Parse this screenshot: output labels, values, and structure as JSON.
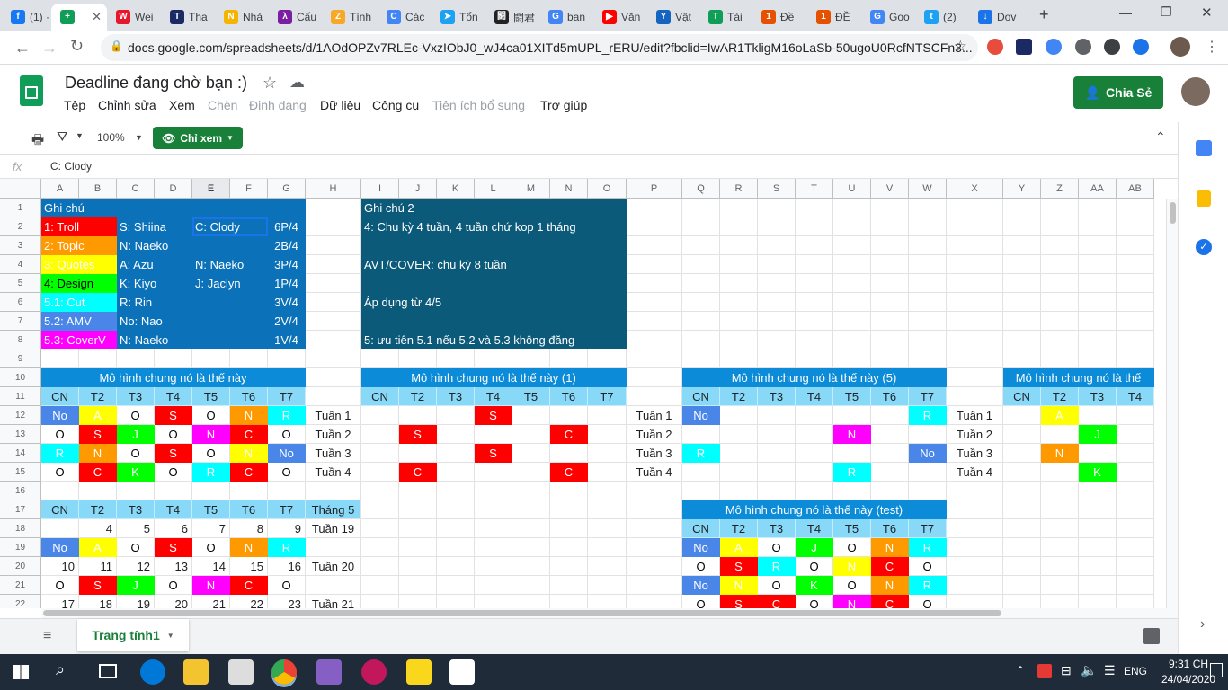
{
  "browser": {
    "tabs": [
      {
        "label": "(1) ·",
        "fav_color": "#1877f2",
        "fav_text": "f"
      },
      {
        "label": "",
        "fav_color": "#0f9d58",
        "fav_text": "+"
      },
      {
        "label": "Wei",
        "fav_color": "#e6162d",
        "fav_text": "W"
      },
      {
        "label": "Tha",
        "fav_color": "#1b2a63",
        "fav_text": "T"
      },
      {
        "label": "Nhả",
        "fav_color": "#f4b400",
        "fav_text": "N"
      },
      {
        "label": "Cấu",
        "fav_color": "#7b1fa2",
        "fav_text": "λ"
      },
      {
        "label": "Tính",
        "fav_color": "#f9a825",
        "fav_text": "Z"
      },
      {
        "label": "Các",
        "fav_color": "#4285f4",
        "fav_text": "C"
      },
      {
        "label": "Tổn",
        "fav_color": "#1da1f2",
        "fav_text": "➤"
      },
      {
        "label": "闘君",
        "fav_color": "#222222",
        "fav_text": "闘"
      },
      {
        "label": "ban",
        "fav_color": "#4285f4",
        "fav_text": "G"
      },
      {
        "label": "Văn",
        "fav_color": "#ff0000",
        "fav_text": "▶"
      },
      {
        "label": "Vật",
        "fav_color": "#1565c0",
        "fav_text": "Y"
      },
      {
        "label": "Tài",
        "fav_color": "#0f9d58",
        "fav_text": "T"
      },
      {
        "label": "Đề",
        "fav_color": "#e65100",
        "fav_text": "1"
      },
      {
        "label": "ĐỀ",
        "fav_color": "#e65100",
        "fav_text": "1"
      },
      {
        "label": "Goo",
        "fav_color": "#4285f4",
        "fav_text": "G"
      },
      {
        "label": "(2)",
        "fav_color": "#1da1f2",
        "fav_text": "t"
      },
      {
        "label": "Dov",
        "fav_color": "#1a73e8",
        "fav_text": "↓"
      }
    ],
    "new_tab": "+",
    "url": "docs.google.com/spreadsheets/d/1AOdOPZv7RLEc-VxzIObJ0_wJ4ca01XITd5mUPL_rERU/edit?fbclid=IwAR1TkligM16oLaSb-50ugoU0RcfNTSCFn3..."
  },
  "sheet": {
    "title": "Deadline đang chờ bạn :)",
    "menu": [
      {
        "label": "Tệp",
        "disabled": false
      },
      {
        "label": "Chỉnh sửa",
        "disabled": false
      },
      {
        "label": "Xem",
        "disabled": false
      },
      {
        "label": "Chèn",
        "disabled": true
      },
      {
        "label": "Định dạng",
        "disabled": true
      },
      {
        "label": "Dữ liệu",
        "disabled": false
      },
      {
        "label": "Công cụ",
        "disabled": false
      },
      {
        "label": "Tiện ích bổ sung",
        "disabled": true
      },
      {
        "label": "Trợ giúp",
        "disabled": false
      }
    ],
    "share_label": "Chia Sẻ",
    "zoom": "100%",
    "view_mode": "Chỉ xem",
    "fx_label": "fx",
    "formula": "C: Clody",
    "sheet_tab": "Trang tính1"
  },
  "grid": {
    "columns": [
      "A",
      "B",
      "C",
      "D",
      "E",
      "F",
      "G",
      "H",
      "I",
      "J",
      "K",
      "L",
      "M",
      "N",
      "O",
      "P",
      "Q",
      "R",
      "S",
      "T",
      "U",
      "V",
      "W",
      "X",
      "Y",
      "Z",
      "AA",
      "AB"
    ],
    "rows": [
      "1",
      "2",
      "3",
      "4",
      "5",
      "6",
      "7",
      "8",
      "9",
      "10",
      "11",
      "12",
      "13",
      "14",
      "15",
      "16",
      "17",
      "18",
      "19",
      "20",
      "21",
      "22"
    ],
    "cells": [
      {
        "r": 0,
        "c": 0,
        "span": 7,
        "t": "Ghi chú",
        "bg": "#0b71b9",
        "fg": "#fff",
        "a": "l"
      },
      {
        "r": 1,
        "c": 0,
        "span": 2,
        "t": "1: Troll",
        "bg": "#ff0000",
        "fg": "#fff",
        "a": "l"
      },
      {
        "r": 2,
        "c": 0,
        "span": 2,
        "t": "2: Topic",
        "bg": "#ff9900",
        "fg": "#fff",
        "a": "l"
      },
      {
        "r": 3,
        "c": 0,
        "span": 2,
        "t": "3: Quotes",
        "bg": "#ffff00",
        "fg": "#fff",
        "a": "l"
      },
      {
        "r": 4,
        "c": 0,
        "span": 2,
        "t": "4: Design",
        "bg": "#00ff00",
        "fg": "#000",
        "a": "l"
      },
      {
        "r": 5,
        "c": 0,
        "span": 2,
        "t": "5.1: Cut",
        "bg": "#00ffff",
        "fg": "#fff",
        "a": "l"
      },
      {
        "r": 6,
        "c": 0,
        "span": 2,
        "t": "5.2: AMV",
        "bg": "#4a86e8",
        "fg": "#fff",
        "a": "l"
      },
      {
        "r": 7,
        "c": 0,
        "span": 2,
        "t": "5.3: CoverV",
        "bg": "#ff00ff",
        "fg": "#fff",
        "a": "l"
      },
      {
        "r": 1,
        "c": 2,
        "span": 2,
        "t": "S: Shiina",
        "bg": "#0b71b9",
        "fg": "#fff",
        "a": "l"
      },
      {
        "r": 2,
        "c": 2,
        "span": 2,
        "t": "N: Naeko",
        "bg": "#0b71b9",
        "fg": "#fff",
        "a": "l"
      },
      {
        "r": 3,
        "c": 2,
        "span": 2,
        "t": "A: Azu",
        "bg": "#0b71b9",
        "fg": "#fff",
        "a": "l"
      },
      {
        "r": 4,
        "c": 2,
        "span": 2,
        "t": "K: Kiyo",
        "bg": "#0b71b9",
        "fg": "#fff",
        "a": "l"
      },
      {
        "r": 5,
        "c": 2,
        "span": 2,
        "t": "R: Rin",
        "bg": "#0b71b9",
        "fg": "#fff",
        "a": "l"
      },
      {
        "r": 6,
        "c": 2,
        "span": 2,
        "t": "No: Nao",
        "bg": "#0b71b9",
        "fg": "#fff",
        "a": "l"
      },
      {
        "r": 7,
        "c": 2,
        "span": 2,
        "t": "N: Naeko",
        "bg": "#0b71b9",
        "fg": "#fff",
        "a": "l"
      },
      {
        "r": 1,
        "c": 4,
        "span": 2,
        "t": "C: Clody",
        "bg": "#0b71b9",
        "fg": "#fff",
        "a": "l",
        "sel": true
      },
      {
        "r": 2,
        "c": 4,
        "span": 2,
        "t": "",
        "bg": "#0b71b9",
        "fg": "#fff",
        "a": "l"
      },
      {
        "r": 3,
        "c": 4,
        "span": 2,
        "t": "N: Naeko",
        "bg": "#0b71b9",
        "fg": "#fff",
        "a": "l"
      },
      {
        "r": 4,
        "c": 4,
        "span": 2,
        "t": "J: Jaclyn",
        "bg": "#0b71b9",
        "fg": "#fff",
        "a": "l"
      },
      {
        "r": 5,
        "c": 4,
        "span": 2,
        "t": "",
        "bg": "#0b71b9",
        "fg": "#fff",
        "a": "l"
      },
      {
        "r": 6,
        "c": 4,
        "span": 2,
        "t": "",
        "bg": "#0b71b9",
        "fg": "#fff",
        "a": "l"
      },
      {
        "r": 7,
        "c": 4,
        "span": 2,
        "t": "",
        "bg": "#0b71b9",
        "fg": "#fff",
        "a": "l"
      },
      {
        "r": 1,
        "c": 6,
        "span": 1,
        "t": "6P/4",
        "bg": "#0b71b9",
        "fg": "#fff",
        "a": "c"
      },
      {
        "r": 2,
        "c": 6,
        "span": 1,
        "t": "2B/4",
        "bg": "#0b71b9",
        "fg": "#fff",
        "a": "c"
      },
      {
        "r": 3,
        "c": 6,
        "span": 1,
        "t": "3P/4",
        "bg": "#0b71b9",
        "fg": "#fff",
        "a": "c"
      },
      {
        "r": 4,
        "c": 6,
        "span": 1,
        "t": "1P/4",
        "bg": "#0b71b9",
        "fg": "#fff",
        "a": "c"
      },
      {
        "r": 5,
        "c": 6,
        "span": 1,
        "t": "3V/4",
        "bg": "#0b71b9",
        "fg": "#fff",
        "a": "c"
      },
      {
        "r": 6,
        "c": 6,
        "span": 1,
        "t": "2V/4",
        "bg": "#0b71b9",
        "fg": "#fff",
        "a": "c"
      },
      {
        "r": 7,
        "c": 6,
        "span": 1,
        "t": "1V/4",
        "bg": "#0b71b9",
        "fg": "#fff",
        "a": "c"
      },
      {
        "r": 0,
        "c": 8,
        "span": 7,
        "t": "Ghi chú 2",
        "bg": "#0c5a7a",
        "fg": "#fff",
        "a": "l"
      },
      {
        "r": 1,
        "c": 8,
        "span": 7,
        "t": "4: Chu kỳ 4 tuần, 4 tuần chứ kop 1 tháng",
        "bg": "#0c5a7a",
        "fg": "#fff",
        "a": "l"
      },
      {
        "r": 2,
        "c": 8,
        "span": 7,
        "t": "",
        "bg": "#0c5a7a",
        "fg": "#fff",
        "a": "l"
      },
      {
        "r": 3,
        "c": 8,
        "span": 7,
        "t": "AVT/COVER: chu kỳ 8 tuần",
        "bg": "#0c5a7a",
        "fg": "#fff",
        "a": "l"
      },
      {
        "r": 4,
        "c": 8,
        "span": 7,
        "t": "",
        "bg": "#0c5a7a",
        "fg": "#fff",
        "a": "l"
      },
      {
        "r": 5,
        "c": 8,
        "span": 7,
        "t": "Áp dụng từ 4/5",
        "bg": "#0c5a7a",
        "fg": "#fff",
        "a": "l"
      },
      {
        "r": 6,
        "c": 8,
        "span": 7,
        "t": "",
        "bg": "#0c5a7a",
        "fg": "#fff",
        "a": "l"
      },
      {
        "r": 7,
        "c": 8,
        "span": 7,
        "t": "5: ưu tiên 5.1 nếu 5.2 và 5.3 không đăng",
        "bg": "#0c5a7a",
        "fg": "#fff",
        "a": "l"
      },
      {
        "r": 9,
        "c": 0,
        "span": 7,
        "t": "Mô hình chung nó là thế này",
        "bg": "#0b8bd8",
        "fg": "#fff",
        "a": "c"
      },
      {
        "r": 9,
        "c": 8,
        "span": 7,
        "t": "Mô hình chung nó là thế này (1)",
        "bg": "#0b8bd8",
        "fg": "#fff",
        "a": "c"
      },
      {
        "r": 9,
        "c": 16,
        "span": 7,
        "t": "Mô hình chung nó là thế này (5)",
        "bg": "#0b8bd8",
        "fg": "#fff",
        "a": "c"
      },
      {
        "r": 9,
        "c": 24,
        "span": 4,
        "t": "Mô hình chung nó là thế",
        "bg": "#0b8bd8",
        "fg": "#fff",
        "a": "c"
      },
      {
        "r": 16,
        "c": 16,
        "span": 7,
        "t": "Mô hình chung nó là thế này (test)",
        "bg": "#0b8bd8",
        "fg": "#fff",
        "a": "c"
      }
    ],
    "day_headers": [
      "CN",
      "T2",
      "T3",
      "T4",
      "T5",
      "T6",
      "T7"
    ],
    "day_header_rows": [
      {
        "r": 10,
        "c": 0
      },
      {
        "r": 10,
        "c": 8
      },
      {
        "r": 10,
        "c": 16
      },
      {
        "r": 10,
        "c": 24
      },
      {
        "r": 16,
        "c": 0
      },
      {
        "r": 17,
        "c": 16
      }
    ],
    "schedule": [
      {
        "r": 11,
        "c": 0,
        "vals": [
          "No",
          "A",
          "O",
          "S",
          "O",
          "N",
          "R"
        ]
      },
      {
        "r": 12,
        "c": 0,
        "vals": [
          "O",
          "S",
          "J",
          "O",
          "N",
          "C",
          "O"
        ]
      },
      {
        "r": 13,
        "c": 0,
        "vals": [
          "R",
          "N",
          "O",
          "S",
          "O",
          "N",
          "No"
        ]
      },
      {
        "r": 14,
        "c": 0,
        "vals": [
          "O",
          "C",
          "K",
          "O",
          "R",
          "C",
          "O"
        ]
      },
      {
        "r": 11,
        "c": 8,
        "vals": [
          "",
          "",
          "",
          "S",
          "",
          "",
          ""
        ]
      },
      {
        "r": 12,
        "c": 8,
        "vals": [
          "",
          "S",
          "",
          "",
          "",
          "C",
          ""
        ]
      },
      {
        "r": 13,
        "c": 8,
        "vals": [
          "",
          "",
          "",
          "S",
          "",
          "",
          ""
        ]
      },
      {
        "r": 14,
        "c": 8,
        "vals": [
          "",
          "C",
          "",
          "",
          "",
          "C",
          ""
        ]
      },
      {
        "r": 11,
        "c": 16,
        "vals": [
          "No",
          "",
          "",
          "",
          "",
          "",
          "R"
        ]
      },
      {
        "r": 12,
        "c": 16,
        "vals": [
          "",
          "",
          "",
          "",
          "N",
          "",
          ""
        ]
      },
      {
        "r": 13,
        "c": 16,
        "vals": [
          "R",
          "",
          "",
          "",
          "",
          "",
          "No"
        ]
      },
      {
        "r": 14,
        "c": 16,
        "vals": [
          "",
          "",
          "",
          "",
          "R",
          "",
          ""
        ]
      },
      {
        "r": 11,
        "c": 24,
        "vals": [
          "",
          "A",
          "",
          ""
        ]
      },
      {
        "r": 12,
        "c": 24,
        "vals": [
          "",
          "",
          "J",
          ""
        ]
      },
      {
        "r": 13,
        "c": 24,
        "vals": [
          "",
          "N",
          "",
          ""
        ]
      },
      {
        "r": 14,
        "c": 24,
        "vals": [
          "",
          "",
          "K",
          ""
        ]
      },
      {
        "r": 18,
        "c": 0,
        "vals": [
          "No",
          "A",
          "O",
          "S",
          "O",
          "N",
          "R"
        ]
      },
      {
        "r": 20,
        "c": 0,
        "vals": [
          "O",
          "S",
          "J",
          "O",
          "N",
          "C",
          "O"
        ]
      },
      {
        "r": 18,
        "c": 16,
        "vals": [
          "No",
          "A",
          "O",
          "J",
          "O",
          "N",
          "R"
        ]
      },
      {
        "r": 19,
        "c": 16,
        "vals": [
          "O",
          "S",
          "R",
          "O",
          "N",
          "C",
          "O"
        ]
      },
      {
        "r": 20,
        "c": 16,
        "vals": [
          "No",
          "N",
          "O",
          "K",
          "O",
          "N",
          "R"
        ]
      },
      {
        "r": 21,
        "c": 16,
        "vals": [
          "O",
          "S",
          "C",
          "O",
          "N",
          "C",
          "O"
        ]
      }
    ],
    "code_colors": {
      "No": "#4a86e8",
      "A": "#ffff00",
      "S": "#ff0000",
      "N": "#ff9900",
      "R": "#00ffff",
      "J": "#00ff00",
      "C": "#ff0000",
      "K": "#00ff00",
      "O": ""
    },
    "nav_n_magenta_cols": [
      4
    ],
    "weeks": [
      {
        "r": 11,
        "c": 7,
        "t": "Tuần 1"
      },
      {
        "r": 12,
        "c": 7,
        "t": "Tuần 2"
      },
      {
        "r": 13,
        "c": 7,
        "t": "Tuần 3"
      },
      {
        "r": 14,
        "c": 7,
        "t": "Tuần 4"
      },
      {
        "r": 11,
        "c": 15,
        "t": "Tuần 1"
      },
      {
        "r": 12,
        "c": 15,
        "t": "Tuần 2"
      },
      {
        "r": 13,
        "c": 15,
        "t": "Tuần 3"
      },
      {
        "r": 14,
        "c": 15,
        "t": "Tuần 4"
      },
      {
        "r": 11,
        "c": 23,
        "t": "Tuần 1"
      },
      {
        "r": 12,
        "c": 23,
        "t": "Tuần 2"
      },
      {
        "r": 13,
        "c": 23,
        "t": "Tuần 3"
      },
      {
        "r": 14,
        "c": 23,
        "t": "Tuần 4"
      }
    ],
    "month_label": "Tháng 5",
    "date_rows": [
      {
        "r": 17,
        "vals": [
          "",
          "4",
          "5",
          "6",
          "7",
          "8",
          "9"
        ],
        "week": "Tuần 19"
      },
      {
        "r": 19,
        "vals": [
          "10",
          "11",
          "12",
          "13",
          "14",
          "15",
          "16"
        ],
        "week": "Tuần 20"
      },
      {
        "r": 21,
        "vals": [
          "17",
          "18",
          "19",
          "20",
          "21",
          "22",
          "23"
        ],
        "week": "Tuần 21"
      }
    ]
  },
  "taskbar": {
    "lang": "ENG",
    "time": "9:31 CH",
    "date": "24/04/2020"
  }
}
